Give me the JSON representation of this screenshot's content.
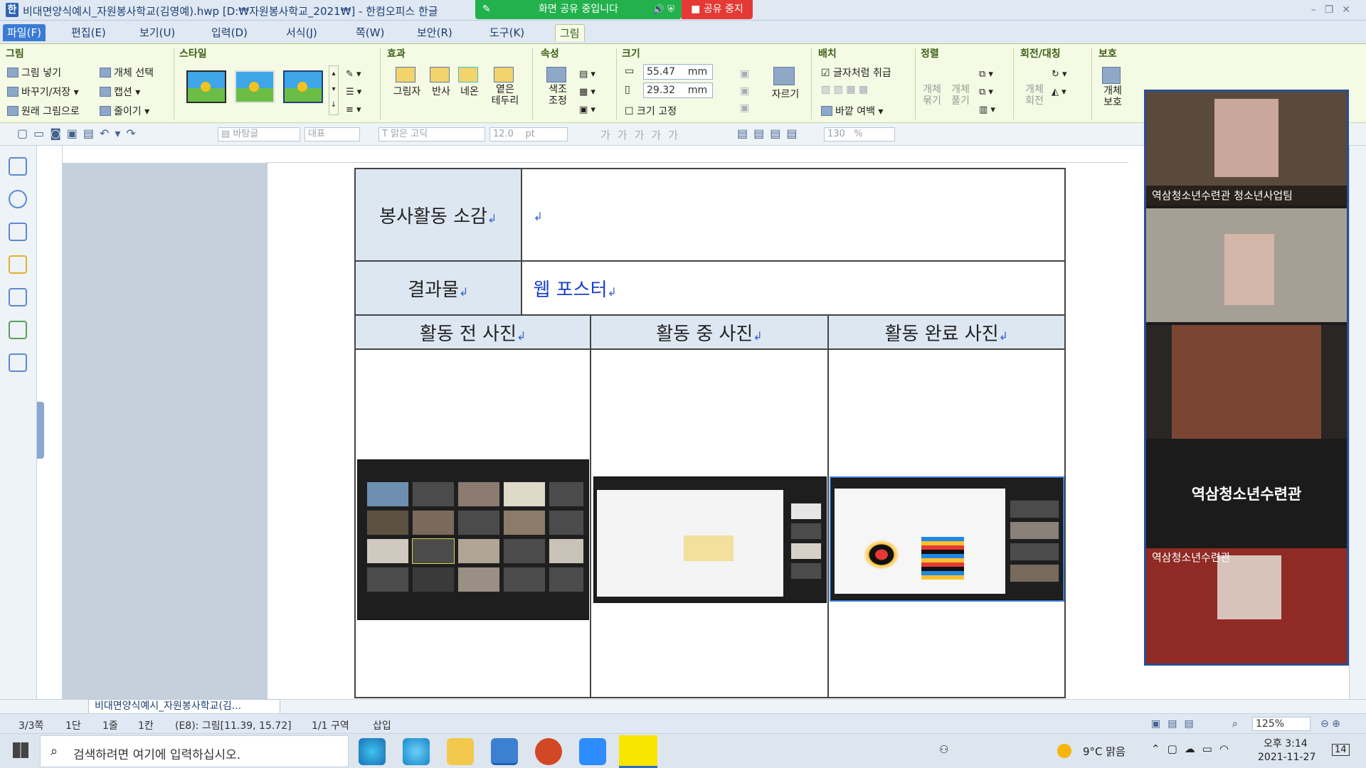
{
  "titlebar": {
    "title": "비대면양식예시_자원봉사학교(김영예).hwp [D:₩자원봉사학교_2021₩] - 한컴오피스 한글",
    "share_status": "화면 공유 중입니다",
    "stop_share": "공유 중지"
  },
  "menubar": {
    "items": [
      "파일(F)",
      "편집(E)",
      "보기(U)",
      "입력(D)",
      "서식(J)",
      "쪽(W)",
      "보안(R)",
      "도구(K)",
      "그림"
    ]
  },
  "ribbon": {
    "group_picture": "그림",
    "insert_picture": "그림 넣기",
    "object_select": "개체 선택",
    "replace_save": "바꾸기/저장",
    "caption": "캡션",
    "original_picture": "원래 그림으로",
    "crop_reduce": "줄이기",
    "group_style": "스타일",
    "group_effect": "효과",
    "shadow": "그림자",
    "reflection": "반사",
    "neon": "네온",
    "soft_edge": "옅은\n테두리",
    "group_property": "속성",
    "color_adjust": "색조\n조정",
    "group_size": "크기",
    "width": "55.47",
    "height": "29.32",
    "unit": "mm",
    "fix_size": "크기 고정",
    "crop": "자르기",
    "group_layout": "배치",
    "treat_as_char": "글자처럼 취급",
    "outer_margin": "바깥 여백",
    "group_align": "정렬",
    "group_obj": "개체\n묶기",
    "ungroup_obj": "개체\n풀기",
    "group_rotate": "회전/대칭",
    "rotate_obj": "개체\n회전",
    "group_protect": "보호",
    "protect_obj": "개체\n보호"
  },
  "toolbar2": {
    "style": "바탕글",
    "rep": "대표",
    "font": "맑은 고딕",
    "size": "12.0",
    "size_unit": "pt",
    "line_spacing": "130",
    "line_unit": "%"
  },
  "document": {
    "row1_label": "봉사활동 소감",
    "row2_label": "결과물",
    "row2_value": "웹 포스터",
    "col_before": "활동 전 사진",
    "col_during": "활동 중 사진",
    "col_after": "활동 완료 사진",
    "para_mark": "↲"
  },
  "zoom_panel": {
    "participant1": "역삼청소년수련관 청소년사업팀",
    "center_name": "역삼청소년수련관",
    "participant4": "역삼청소년수련관"
  },
  "doc_tab": "비대면양식예시_자원봉사학교(김...",
  "statusbar": {
    "page": "3/3쪽",
    "dan": "1단",
    "line": "1줄",
    "col": "1칸",
    "cell": "(E8): 그림[11.39, 15.72]",
    "section": "1/1 구역",
    "mode": "삽입",
    "zoom": "125%"
  },
  "taskbar": {
    "search_placeholder": "검색하려면 여기에 입력하십시오.",
    "weather": "9°C 맑음",
    "time": "오후 3:14",
    "date": "2021-11-27",
    "notif": "14"
  }
}
